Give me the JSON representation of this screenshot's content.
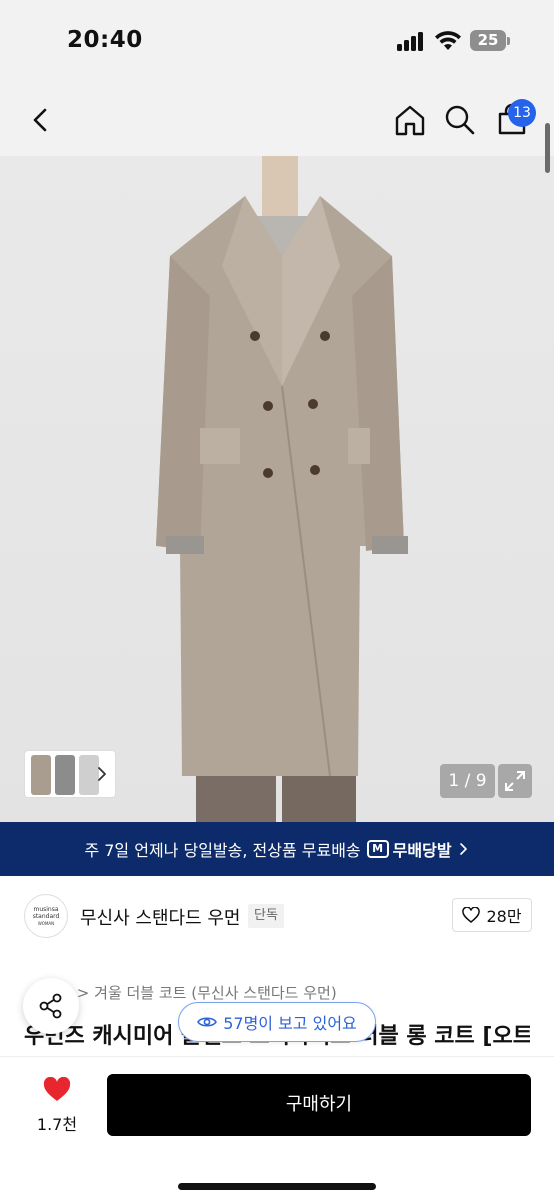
{
  "status_bar": {
    "time": "20:40",
    "battery": "25"
  },
  "nav": {
    "cart_badge": "13",
    "icons": [
      "back-chevron-icon",
      "home-icon",
      "search-icon",
      "cart-icon"
    ]
  },
  "gallery": {
    "counter": "1 / 9"
  },
  "delivery_banner": {
    "text": "주 7일 언제나 당일발송, 전상품 무료배송",
    "badge_logo": "M",
    "badge_label": "무배당발"
  },
  "brand": {
    "logo_line1": "musinsa",
    "logo_line2": "standard",
    "logo_line3": "WOMAN",
    "name": "무신사 스탠다드 우먼",
    "exclusive": "단독",
    "likes": "28만"
  },
  "product": {
    "breadcrumb_separator": ">",
    "breadcrumb_category": "겨울 더블 코트 (무신사 스탠다드 우먼)",
    "title": "우먼즈 캐시미어 블렌드 오버사이즈 더블 롱 코트 [오트"
  },
  "viewers": {
    "text": "57명이 보고 있어요"
  },
  "bottom_bar": {
    "wish_count": "1.7천",
    "buy_label": "구매하기"
  },
  "colors": {
    "banner_bg": "#0d2b6b",
    "cart_badge_bg": "#2563eb",
    "heart": "#e8262e",
    "viewers_text": "#2d63d8"
  }
}
